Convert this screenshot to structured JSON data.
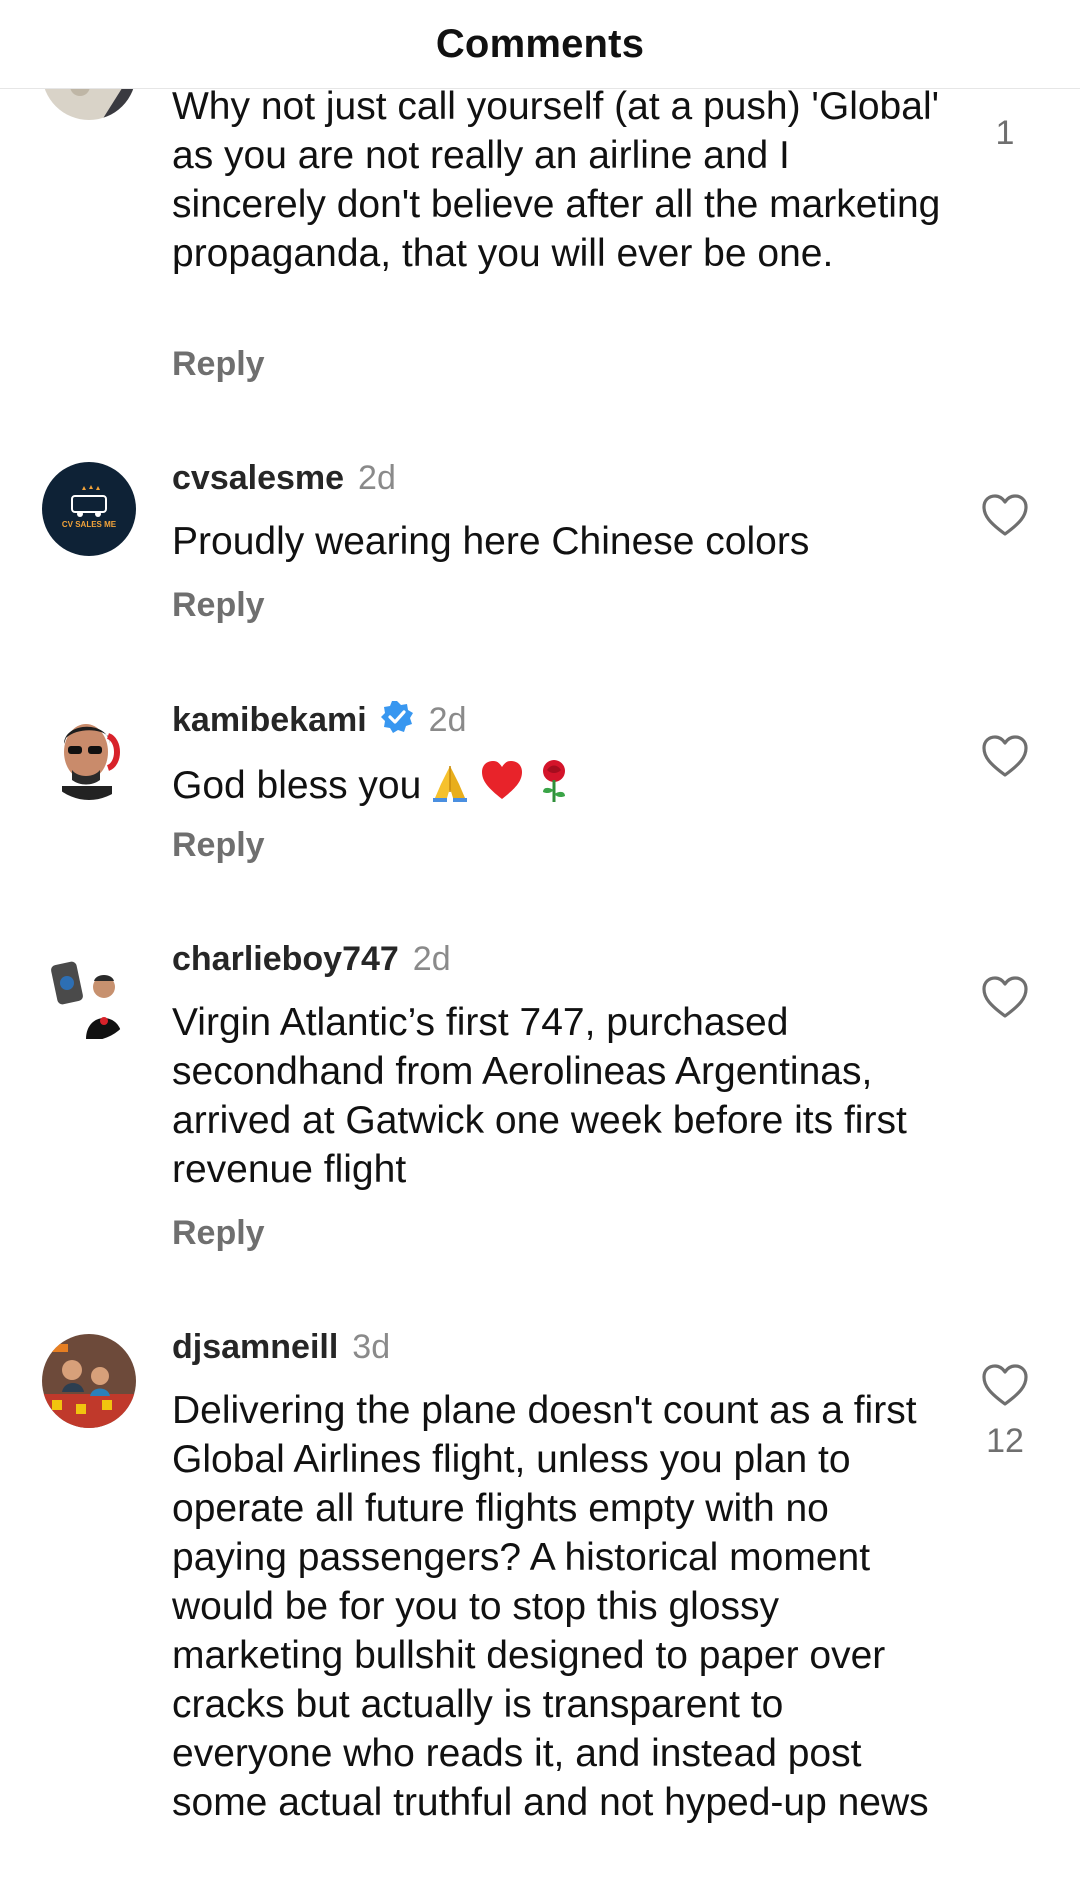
{
  "header": {
    "title": "Comments"
  },
  "comments": [
    {
      "text": "Why not just call yourself (at a push) 'Global' as you are not really an airline and I sincerely don't believe after all the marketing propaganda, that you will ever be one.",
      "reply_label": "Reply",
      "likes": "1"
    },
    {
      "username": "cvsalesme",
      "time": "2d",
      "avatar_label": "CV SALES ME",
      "text": "Proudly wearing here Chinese colors",
      "reply_label": "Reply"
    },
    {
      "username": "kamibekami",
      "time": "2d",
      "verified": true,
      "text": "God bless you",
      "emojis": [
        "folded-hands-icon",
        "red-heart-icon",
        "rose-icon"
      ],
      "reply_label": "Reply"
    },
    {
      "username": "charlieboy747",
      "time": "2d",
      "text": "Virgin Atlantic’s first 747, purchased secondhand from Aerolineas Argentinas, arrived at Gatwick one week before its first revenue flight",
      "reply_label": "Reply"
    },
    {
      "username": "djsamneill",
      "time": "3d",
      "text": "Delivering the plane doesn't count as a first Global Airlines flight, unless you plan to operate all future flights empty with no paying passengers? A historical moment would be for you to stop this glossy marketing bullshit designed to paper over cracks but actually is transparent to everyone who reads it, and instead post some actual truthful and not hyped-up news",
      "likes": "12"
    }
  ],
  "colors": {
    "verified": "#3897f0",
    "heart_outline": "#6f6f6f",
    "secondary_text": "#8a8a8a"
  }
}
